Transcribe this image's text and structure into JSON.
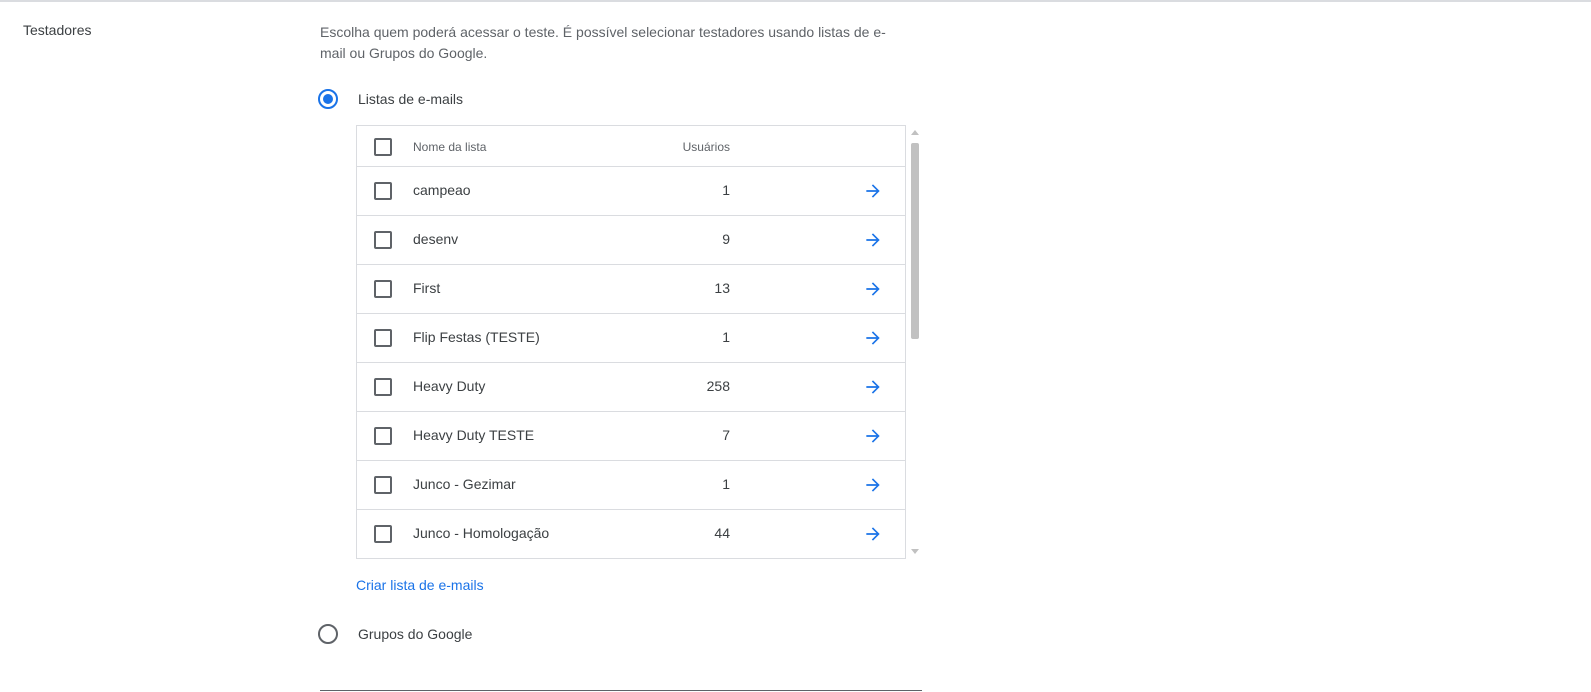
{
  "section": {
    "label": "Testadores",
    "description": "Escolha quem poderá acessar o teste. É possível selecionar testadores usando listas de e-mail ou Grupos do Google."
  },
  "options": {
    "email_lists": {
      "label": "Listas de e-mails",
      "selected": true
    },
    "google_groups": {
      "label": "Grupos do Google",
      "selected": false
    }
  },
  "table": {
    "columns": {
      "name": "Nome da lista",
      "users": "Usuários"
    },
    "rows": [
      {
        "name": "campeao",
        "users": "1"
      },
      {
        "name": "desenv",
        "users": "9"
      },
      {
        "name": "First",
        "users": "13"
      },
      {
        "name": "Flip Festas (TESTE)",
        "users": "1"
      },
      {
        "name": "Heavy Duty",
        "users": "258"
      },
      {
        "name": "Heavy Duty TESTE",
        "users": "7"
      },
      {
        "name": "Junco - Gezimar",
        "users": "1"
      },
      {
        "name": "Junco - Homologação",
        "users": "44"
      }
    ]
  },
  "create_list_label": "Criar lista de e-mails",
  "icons": {
    "row_action": "arrow-right-icon"
  },
  "colors": {
    "accent": "#1a73e8",
    "text": "#3c4043",
    "muted": "#5f6368",
    "border": "#dadce0"
  }
}
